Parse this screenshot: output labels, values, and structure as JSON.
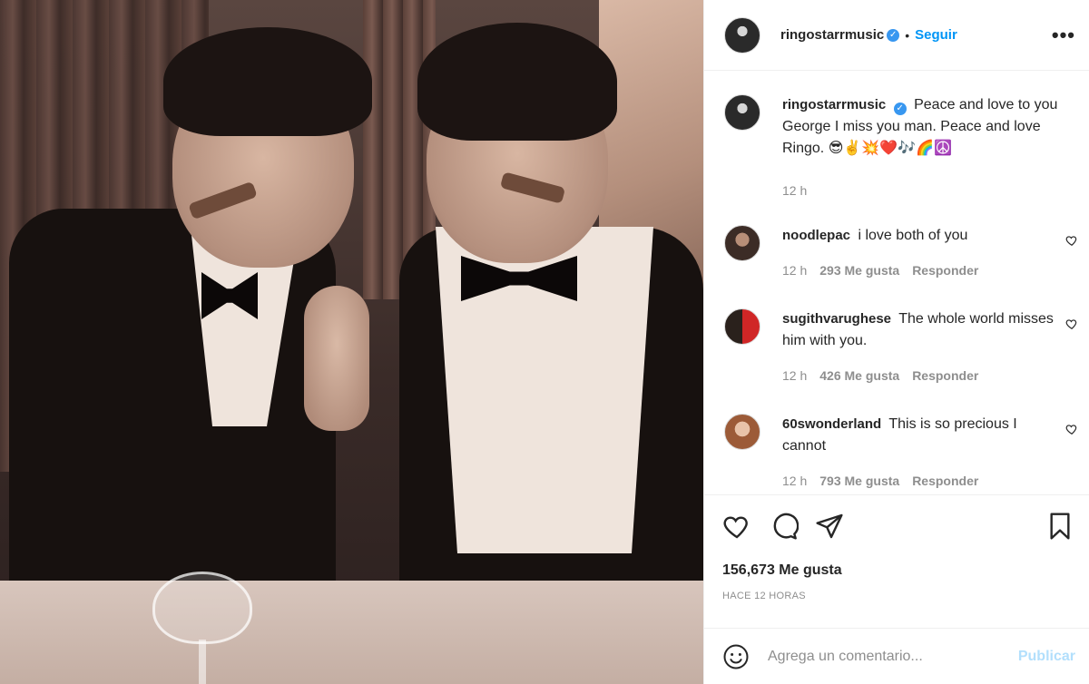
{
  "header": {
    "username": "ringostarrmusic",
    "verified_mark": "✓",
    "separator": "•",
    "follow_label": "Seguir",
    "more_label": "•••"
  },
  "caption": {
    "username": "ringostarrmusic",
    "text": "Peace and love to you George I miss you man. Peace and love Ringo. 😎✌️💥❤️🎶🌈☮️",
    "time": "12 h"
  },
  "comments": [
    {
      "username": "noodlepac",
      "text": "i love both of you",
      "time": "12 h",
      "likes": "293 Me gusta",
      "reply": "Responder"
    },
    {
      "username": "sugithvarughese",
      "text": "The whole world misses him with you.",
      "time": "12 h",
      "likes": "426 Me gusta",
      "reply": "Responder"
    },
    {
      "username": "60swonderland",
      "text": "This is so precious I cannot",
      "time": "12 h",
      "likes": "793 Me gusta",
      "reply": "Responder"
    }
  ],
  "actions": {
    "likes_total": "156,673 Me gusta",
    "timestamp": "HACE 12 HORAS",
    "icons": [
      "heart-icon",
      "comment-icon",
      "share-icon",
      "bookmark-icon"
    ]
  },
  "composer": {
    "placeholder": "Agrega un comentario...",
    "value": "",
    "publish_label": "Publicar"
  },
  "colors": {
    "accent": "#0095f6",
    "publish_disabled": "#b2dffc",
    "muted": "#8e8e8e",
    "verified": "#3897f0"
  }
}
